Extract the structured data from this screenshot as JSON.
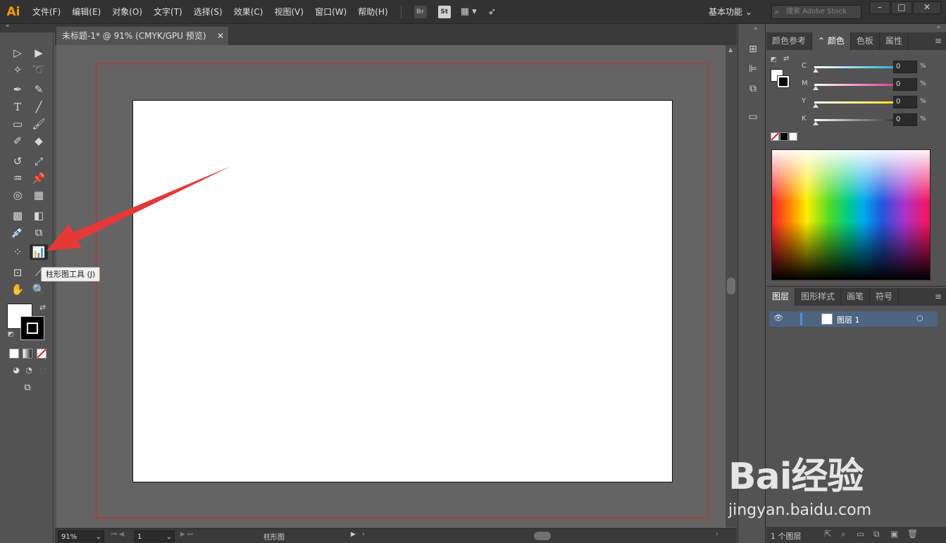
{
  "app": {
    "logo": "Ai",
    "menu": [
      "文件(F)",
      "编辑(E)",
      "对象(O)",
      "文字(T)",
      "选择(S)",
      "效果(C)",
      "视图(V)",
      "窗口(W)",
      "帮助(H)"
    ],
    "bridge_badge": "Br",
    "stock_badge": "St",
    "workspace": "基本功能",
    "search_placeholder": "搜索 Adobe Stock"
  },
  "document": {
    "tab_title": "未标题-1* @ 91% (CMYK/GPU 预览)"
  },
  "tooltip": "柱形图工具 (J)",
  "status": {
    "zoom": "91%",
    "page": "1",
    "tool_name": "柱形图"
  },
  "color_panel": {
    "tabs": [
      "颜色参考",
      "颜色",
      "色板",
      "属性"
    ],
    "active_tab": "颜色",
    "channels": [
      {
        "label": "C",
        "value": "0",
        "unit": "%",
        "color": "#1ba7e0"
      },
      {
        "label": "M",
        "value": "0",
        "unit": "%",
        "color": "#e0288c"
      },
      {
        "label": "Y",
        "value": "0",
        "unit": "%",
        "color": "#f0e000"
      },
      {
        "label": "K",
        "value": "0",
        "unit": "%",
        "color": "#222222"
      }
    ]
  },
  "layers_panel": {
    "tabs": [
      "图层",
      "图形样式",
      "画笔",
      "符号"
    ],
    "active_tab": "图层",
    "layers": [
      {
        "name": "图层 1",
        "visible": true
      }
    ],
    "count": "1 个图层"
  },
  "watermark": {
    "text": "Bai经验",
    "url": "jingyan.baidu.com"
  },
  "colors": {
    "bleed": "#d22222",
    "selected_layer": "#4c6480",
    "accent_logo": "#ff9a00"
  }
}
